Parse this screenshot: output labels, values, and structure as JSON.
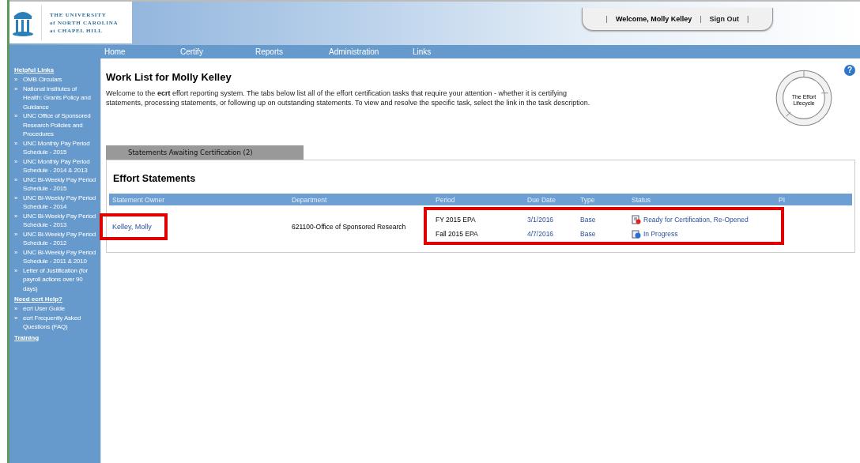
{
  "header": {
    "logo_lines": [
      "THE UNIVERSITY",
      "of NORTH CAROLINA",
      "at CHAPEL HILL"
    ],
    "welcome": "Welcome, Molly Kelley",
    "sign_out": "Sign Out",
    "separator": "|"
  },
  "nav": [
    "Home",
    "Certify",
    "Reports",
    "Administration",
    "Links"
  ],
  "sidebar": [
    {
      "heading": "Helpful Links",
      "items": [
        "OMB Circulars",
        "National Institutes of Health: Grants Policy and Guidance",
        "UNC Office of Sponsored Research Policies and Procedures",
        "UNC Monthly Pay Period Schedule - 2015",
        "UNC Monthly Pay Period Schedule - 2014 & 2013",
        "UNC Bi-Weekly Pay Period Schedule - 2015",
        "UNC Bi-Weekly Pay Period Schedule - 2014",
        "UNC Bi-Weekly Pay Period Schedule - 2013",
        "UNC Bi-Weekly Pay Period Schedule - 2012",
        "UNC Bi-Weekly Pay Period Schedule - 2011 & 2010",
        "Letter of Justification (for payroll actions over 90 days)"
      ]
    },
    {
      "heading": "Need ecrt Help?",
      "items": [
        "ecrt User Guide",
        "ecrt Frequently Asked Questions (FAQ)"
      ]
    },
    {
      "heading": "Training"
    }
  ],
  "bullet": "»",
  "page": {
    "title": "Work List for Molly Kelley",
    "intro": "Welcome to the **ecrt** effort reporting system. The tabs below list all of the effort certification tasks that require your attention - whether it is certifying statements, processing statements, or following up on outstanding statements. To view and resolve the specific task, select the link in the task description.",
    "lifecycle_label": "The Effort Lifecycle",
    "help": "?"
  },
  "tabs": [
    {
      "label": "Statements Awaiting Certification (2)",
      "selected": true
    }
  ],
  "table": {
    "title": "Effort Statements",
    "columns": [
      "Statement Owner",
      "Department",
      "Period",
      "Due Date",
      "Type",
      "Status",
      "PI"
    ],
    "groups": [
      {
        "owner": "Kelley, Molly",
        "department": "621100-Office of Sponsored Research",
        "owner_highlighted": true,
        "statements_highlighted": true,
        "statements": [
          {
            "period": "FY 2015 EPA",
            "due_date": "3/1/2016",
            "type": "Base",
            "status": "Ready for Certification, Re-Opened",
            "kind": "ready"
          },
          {
            "period": "Fall 2015 EPA",
            "due_date": "4/7/2016",
            "type": "Base",
            "status": "In Progress",
            "kind": "progress"
          }
        ]
      }
    ]
  }
}
